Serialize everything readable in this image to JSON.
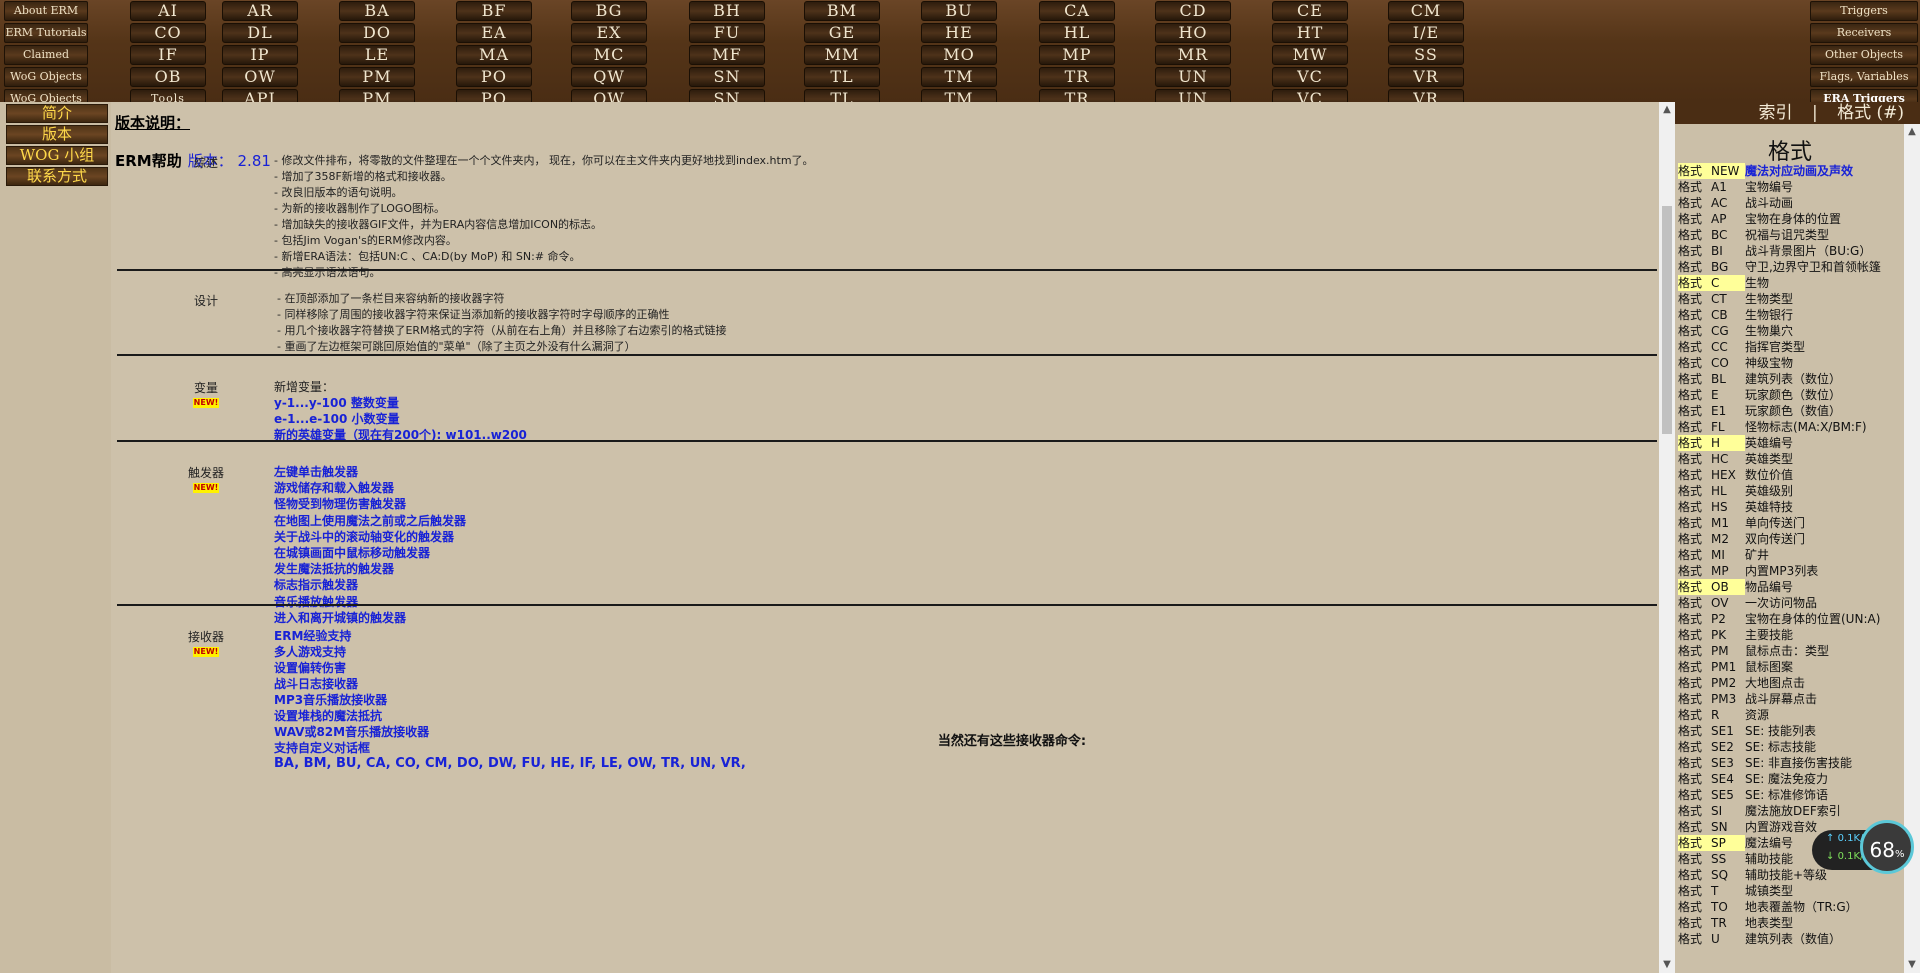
{
  "top_left_links": [
    "About ERM",
    "ERM Tutorials",
    "Claimed",
    "WoG Objects",
    "WoG Objects"
  ],
  "receiver_columns": [
    [
      "AI",
      "CO",
      "IF",
      "OB",
      "Tools"
    ],
    [
      "AR",
      "DL",
      "IP",
      "OW",
      "API"
    ],
    [
      "BA",
      "DO",
      "LE",
      "PM",
      "PM"
    ],
    [
      "BF",
      "EA",
      "MA",
      "PO",
      "PO"
    ],
    [
      "BG",
      "EX",
      "MC",
      "QW",
      "QW"
    ],
    [
      "BH",
      "FU",
      "MF",
      "SN",
      "SN"
    ],
    [
      "BM",
      "GE",
      "MM",
      "TL",
      "TL"
    ],
    [
      "BU",
      "HE",
      "MO",
      "TM",
      "TM"
    ],
    [
      "CA",
      "HL",
      "MP",
      "TR",
      "TR"
    ],
    [
      "CD",
      "HO",
      "MR",
      "UN",
      "UN"
    ],
    [
      "CE",
      "HT",
      "MW",
      "VC",
      "VC"
    ],
    [
      "CM",
      "I/E",
      "SS",
      "VR",
      "VR"
    ]
  ],
  "top_right_links": [
    "Triggers",
    "Receivers",
    "Other Objects",
    "Flags, Variables",
    "ERA Triggers"
  ],
  "left_menu": [
    "简介",
    "版本",
    "WOG 小组",
    "联系方式"
  ],
  "header": {
    "title": "版本说明：",
    "help_label": "ERM帮助",
    "version": "版本： 2.81"
  },
  "new_badge": "NEW!",
  "sections": {
    "overview": {
      "label": "综述",
      "items": [
        "- 修改文件排布，将零散的文件整理在一个个文件夹内， 现在，你可以在主文件夹内更好地找到index.htm了。",
        "- 增加了358F新增的格式和接收器。",
        "- 改良旧版本的语句说明。",
        "- 为新的接收器制作了LOGO图标。",
        "- 增加缺失的接收器GIF文件，并为ERA内容信息增加ICON的标志。",
        "- 包括Jim Vogan's的ERM修改内容。",
        "- 新增ERA语法：包括UN:C 、CA:D(by MoP) 和 SN:# 命令。",
        "- 高亮显示语法语句。"
      ]
    },
    "design": {
      "label": "设计",
      "items": [
        "- 在顶部添加了一条栏目来容纳新的接收器字符",
        "- 同样移除了周围的接收器字符来保证当添加新的接收器字符时字母顺序的正确性",
        "- 用几个接收器字符替换了ERM格式的字符（从前在右上角）并且移除了右边索引的格式链接",
        "- 重画了左边框架可跳回原始值的\"菜单\"（除了主页之外没有什么漏洞了）"
      ]
    },
    "variables": {
      "label": "变量",
      "intro": "新增变量：",
      "items": [
        "y-1...y-100 整数变量",
        "e-1...e-100 小数变量",
        "新的英雄变量（现在有200个): w101..w200"
      ]
    },
    "triggers": {
      "label": "触发器",
      "items": [
        "左键单击触发器",
        "游戏储存和载入触发器",
        "怪物受到物理伤害触发器",
        "在地图上使用魔法之前或之后触发器",
        "关于战斗中的滚动轴变化的触发器",
        "在城镇画面中鼠标移动触发器",
        "发生魔法抵抗的触发器",
        "标志指示触发器",
        "音乐播放触发器",
        "进入和离开城镇的触发器"
      ]
    },
    "receivers": {
      "label": "接收器",
      "items": [
        "ERM经验支持",
        "多人游戏支持",
        "设置偏转伤害",
        "战斗日志接收器",
        "MP3音乐播放接收器",
        "设置堆栈的魔法抵抗",
        "WAV或82M音乐播放接收器",
        "支持自定义对话框"
      ]
    }
  },
  "also": {
    "title": "当然还有这些接收器命令:",
    "list": "BA, BM, BU, CA, CO, CM, DO, DW, FU, HE, IF, LE, OW, TR, UN, VR,"
  },
  "right_tabs": [
    "索引",
    "|",
    "格式 (#)"
  ],
  "right_heading": "格式",
  "right_index": [
    {
      "f": "格式",
      "c": "NEW",
      "d": "魔法对应动画及声效",
      "hl": true,
      "new": true
    },
    {
      "f": "格式",
      "c": "A1",
      "d": "宝物编号"
    },
    {
      "f": "格式",
      "c": "AC",
      "d": "战斗动画"
    },
    {
      "f": "格式",
      "c": "AP",
      "d": "宝物在身体的位置"
    },
    {
      "f": "格式",
      "c": "BC",
      "d": "祝福与诅咒类型"
    },
    {
      "f": "格式",
      "c": "BI",
      "d": "战斗背景图片（BU:G）"
    },
    {
      "f": "格式",
      "c": "BG",
      "d": "守卫,边界守卫和首领帐篷"
    },
    {
      "f": "格式",
      "c": "C",
      "d": "生物",
      "hl": true
    },
    {
      "f": "格式",
      "c": "CT",
      "d": "生物类型"
    },
    {
      "f": "格式",
      "c": "CB",
      "d": "生物银行"
    },
    {
      "f": "格式",
      "c": "CG",
      "d": "生物巢穴"
    },
    {
      "f": "格式",
      "c": "CC",
      "d": "指挥官类型"
    },
    {
      "f": "格式",
      "c": "CO",
      "d": "神级宝物"
    },
    {
      "f": "格式",
      "c": "BL",
      "d": "建筑列表（数位）"
    },
    {
      "f": "格式",
      "c": "E",
      "d": "玩家颜色（数位）"
    },
    {
      "f": "格式",
      "c": "E1",
      "d": "玩家颜色（数值）"
    },
    {
      "f": "格式",
      "c": "FL",
      "d": "怪物标志(MA:X/BM:F)"
    },
    {
      "f": "格式",
      "c": "H",
      "d": "英雄编号",
      "hl": true
    },
    {
      "f": "格式",
      "c": "HC",
      "d": "英雄类型"
    },
    {
      "f": "格式",
      "c": "HEX",
      "d": "数位价值"
    },
    {
      "f": "格式",
      "c": "HL",
      "d": "英雄级别"
    },
    {
      "f": "格式",
      "c": "HS",
      "d": "英雄特技"
    },
    {
      "f": "格式",
      "c": "M1",
      "d": "单向传送门"
    },
    {
      "f": "格式",
      "c": "M2",
      "d": "双向传送门"
    },
    {
      "f": "格式",
      "c": "MI",
      "d": "矿井"
    },
    {
      "f": "格式",
      "c": "MP",
      "d": "内置MP3列表"
    },
    {
      "f": "格式",
      "c": "OB",
      "d": "物品编号",
      "hl": true
    },
    {
      "f": "格式",
      "c": "OV",
      "d": "一次访问物品"
    },
    {
      "f": "格式",
      "c": "P2",
      "d": "宝物在身体的位置(UN:A)"
    },
    {
      "f": "格式",
      "c": "PK",
      "d": "主要技能"
    },
    {
      "f": "格式",
      "c": "PM",
      "d": "鼠标点击：类型"
    },
    {
      "f": "格式",
      "c": "PM1",
      "d": "鼠标图案"
    },
    {
      "f": "格式",
      "c": "PM2",
      "d": "大地图点击"
    },
    {
      "f": "格式",
      "c": "PM3",
      "d": "战斗屏幕点击"
    },
    {
      "f": "格式",
      "c": "R",
      "d": "资源"
    },
    {
      "f": "格式",
      "c": "SE1",
      "d": "SE: 技能列表"
    },
    {
      "f": "格式",
      "c": "SE2",
      "d": "SE: 标志技能"
    },
    {
      "f": "格式",
      "c": "SE3",
      "d": "SE: 非直接伤害技能"
    },
    {
      "f": "格式",
      "c": "SE4",
      "d": "SE: 魔法免疫力"
    },
    {
      "f": "格式",
      "c": "SE5",
      "d": "SE: 标准修饰语"
    },
    {
      "f": "格式",
      "c": "SI",
      "d": "魔法施放DEF索引"
    },
    {
      "f": "格式",
      "c": "SN",
      "d": "内置游戏音效"
    },
    {
      "f": "格式",
      "c": "SP",
      "d": "魔法编号",
      "hl": true
    },
    {
      "f": "格式",
      "c": "SS",
      "d": "辅助技能"
    },
    {
      "f": "格式",
      "c": "SQ",
      "d": "辅助技能+等级"
    },
    {
      "f": "格式",
      "c": "T",
      "d": "城镇类型"
    },
    {
      "f": "格式",
      "c": "TO",
      "d": "地表覆盖物（TR:G）"
    },
    {
      "f": "格式",
      "c": "TR",
      "d": "地表类型"
    },
    {
      "f": "格式",
      "c": "U",
      "d": "建筑列表（数值）"
    }
  ],
  "speed_widget": {
    "up": "0.1K/s",
    "down": "0.1K/s",
    "percent": "68",
    "unit": "%"
  }
}
